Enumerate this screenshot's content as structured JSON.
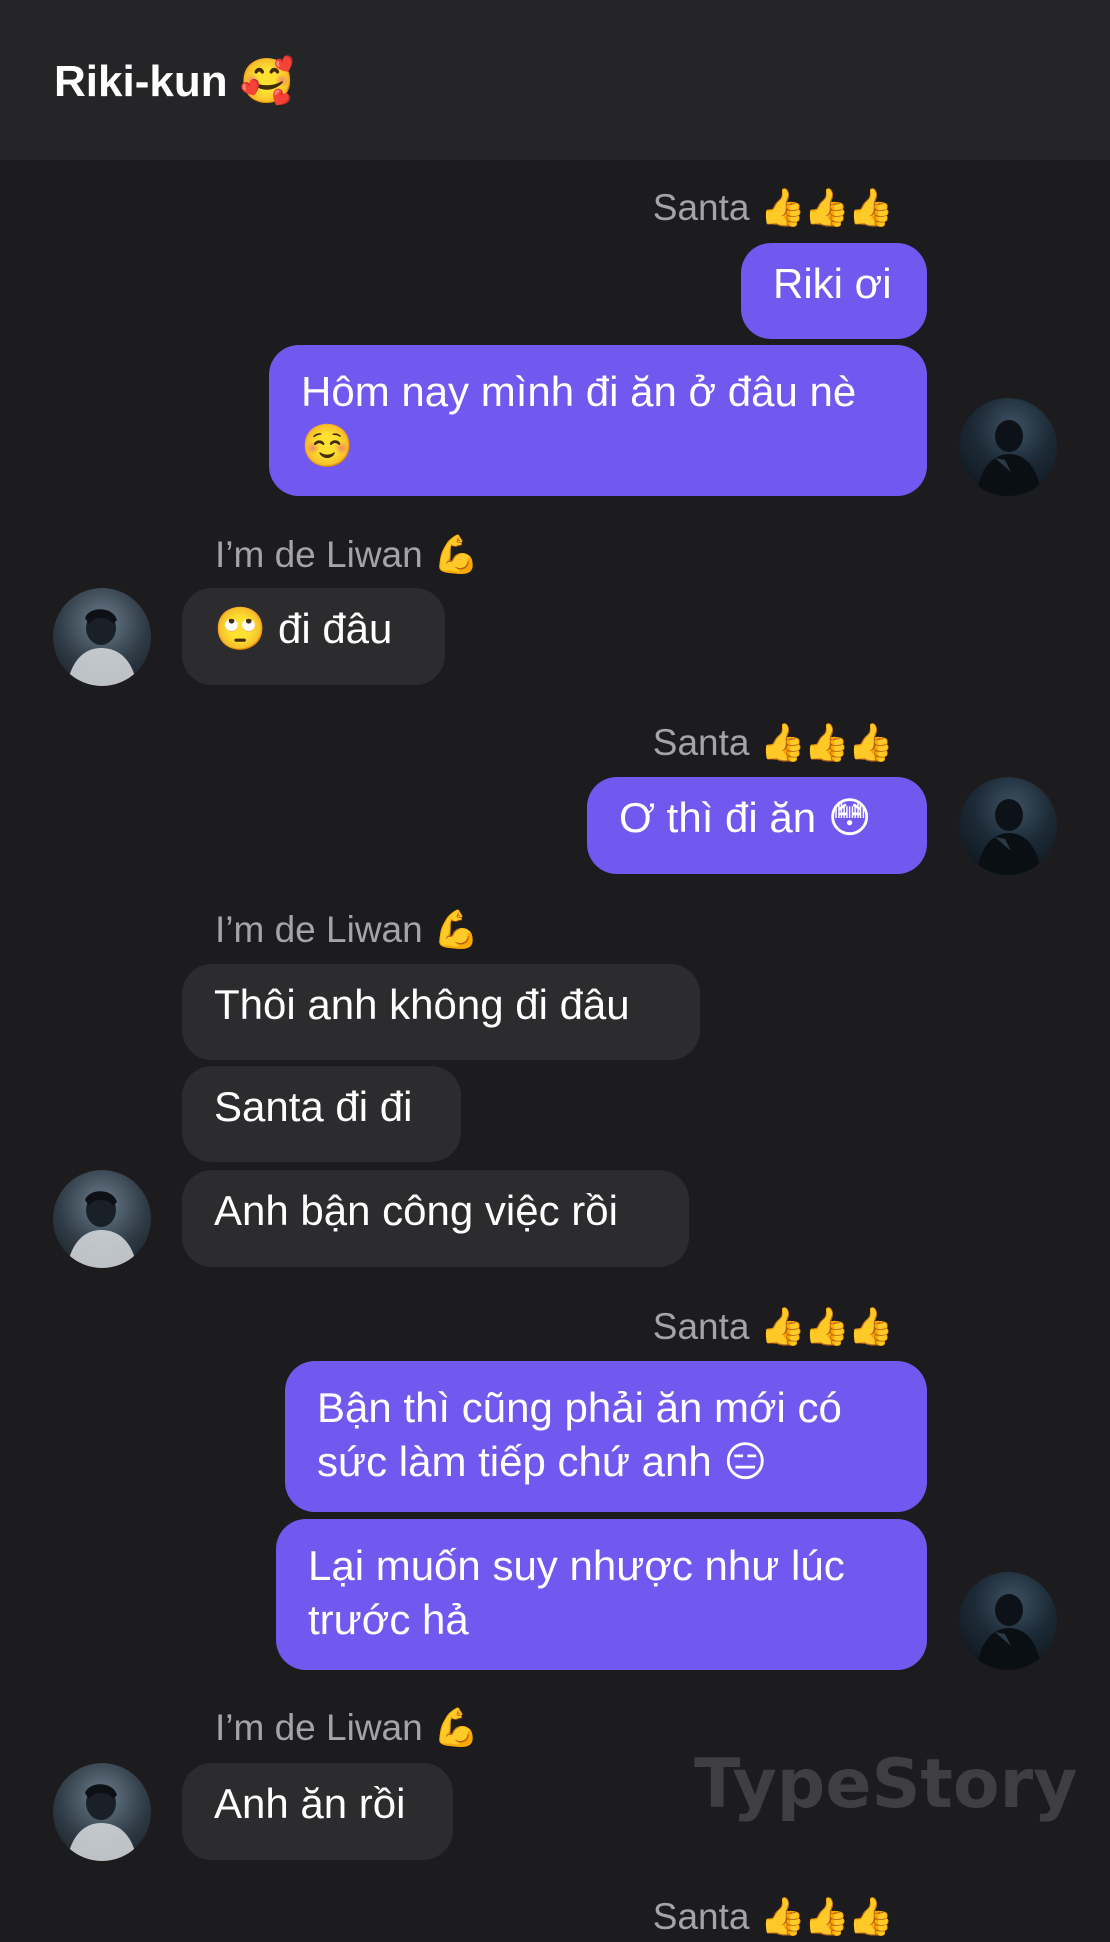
{
  "header": {
    "title": "Riki-kun 🥰"
  },
  "senders": {
    "santa": {
      "name": "Santa",
      "emoji": "👍👍👍"
    },
    "liwan": {
      "name": "I’m de Liwan",
      "emoji": "💪"
    }
  },
  "messages": [
    {
      "from": "santa",
      "text": "Riki ơi"
    },
    {
      "from": "santa",
      "text": "Hôm nay mình đi ăn ở đâu nè ☺️"
    },
    {
      "from": "liwan",
      "text": "🙄 đi đâu"
    },
    {
      "from": "santa",
      "text": "Ơ thì đi ăn 😳"
    },
    {
      "from": "liwan",
      "text": "Thôi anh không đi đâu"
    },
    {
      "from": "liwan",
      "text": "Santa đi đi"
    },
    {
      "from": "liwan",
      "text": "Anh bận công việc rồi"
    },
    {
      "from": "santa",
      "text": "Bận thì cũng phải ăn mới có sức làm tiếp chứ anh 😑"
    },
    {
      "from": "santa",
      "text": "Lại muốn suy nhược như lúc trước hả"
    },
    {
      "from": "liwan",
      "text": "Anh ăn rồi"
    }
  ],
  "watermark": "TypeStory",
  "colors": {
    "background": "#1c1c1e",
    "header": "#252527",
    "outgoing_bubble": "#7159f0",
    "incoming_bubble": "#2c2c2e",
    "sender_label": "#a3a3a8"
  }
}
